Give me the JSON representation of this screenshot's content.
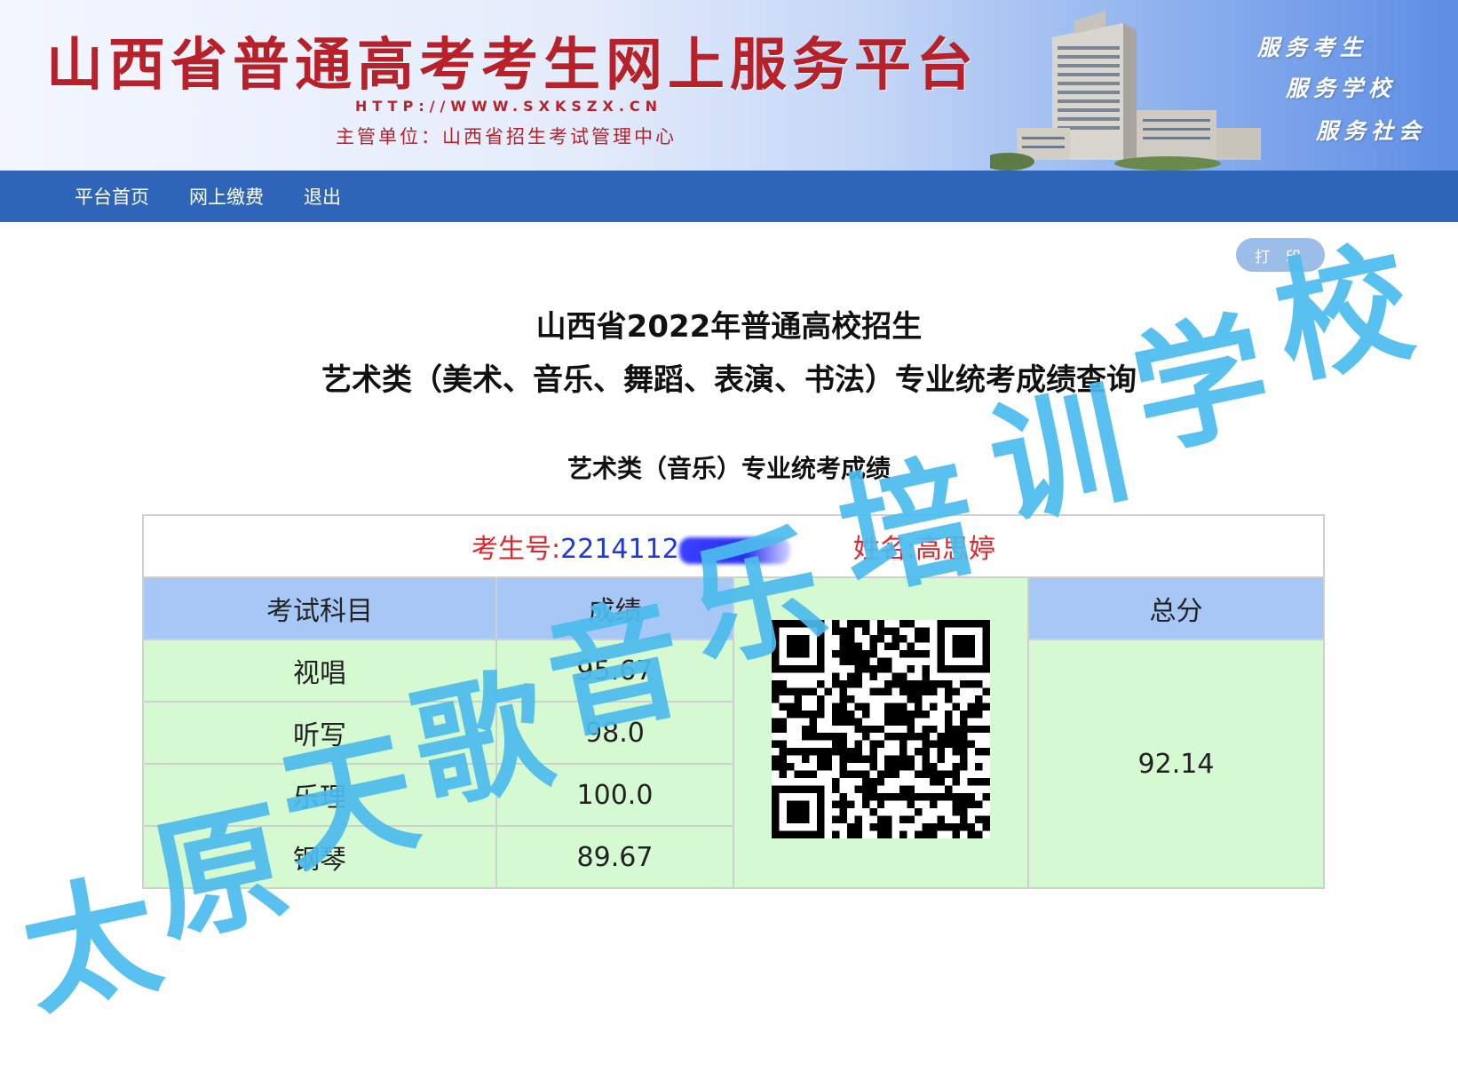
{
  "header": {
    "title": "山西省普通高考考生网上服务平台",
    "url": "HTTP://WWW.SXKSZX.CN",
    "org": "主管单位：山西省招生考试管理中心",
    "slogans": [
      "服务考生",
      "服务学校",
      "服务社会"
    ]
  },
  "nav": {
    "items": [
      "平台首页",
      "网上缴费",
      "退出"
    ]
  },
  "print_label": "打 印",
  "titles": {
    "line1": "山西省2022年普通高校招生",
    "line2": "艺术类（美术、音乐、舞蹈、表演、书法）专业统考成绩查询",
    "line3": "艺术类（音乐）专业统考成绩"
  },
  "student": {
    "id_label": "考生号:",
    "id_visible": "2214112",
    "name_label": "姓名:",
    "name": "高思婷"
  },
  "table": {
    "headers": {
      "subject": "考试科目",
      "score": "成绩",
      "total": "总分"
    },
    "rows": [
      {
        "subject": "视唱",
        "score": "95.67"
      },
      {
        "subject": "听写",
        "score": "98.0"
      },
      {
        "subject": "乐理",
        "score": "100.0"
      },
      {
        "subject": "钢琴",
        "score": "89.67"
      }
    ],
    "total": "92.14"
  },
  "watermark": {
    "text": "太原天歌音乐培训学校",
    "color": "#4cbcee"
  },
  "colors": {
    "header_red": "#b8202a",
    "nav_blue": "#2f65b8",
    "table_header": "#a7c8f7",
    "table_body": "#d5f9d1"
  },
  "icons": {
    "building": "building-illustration",
    "qr": "qr-code"
  }
}
